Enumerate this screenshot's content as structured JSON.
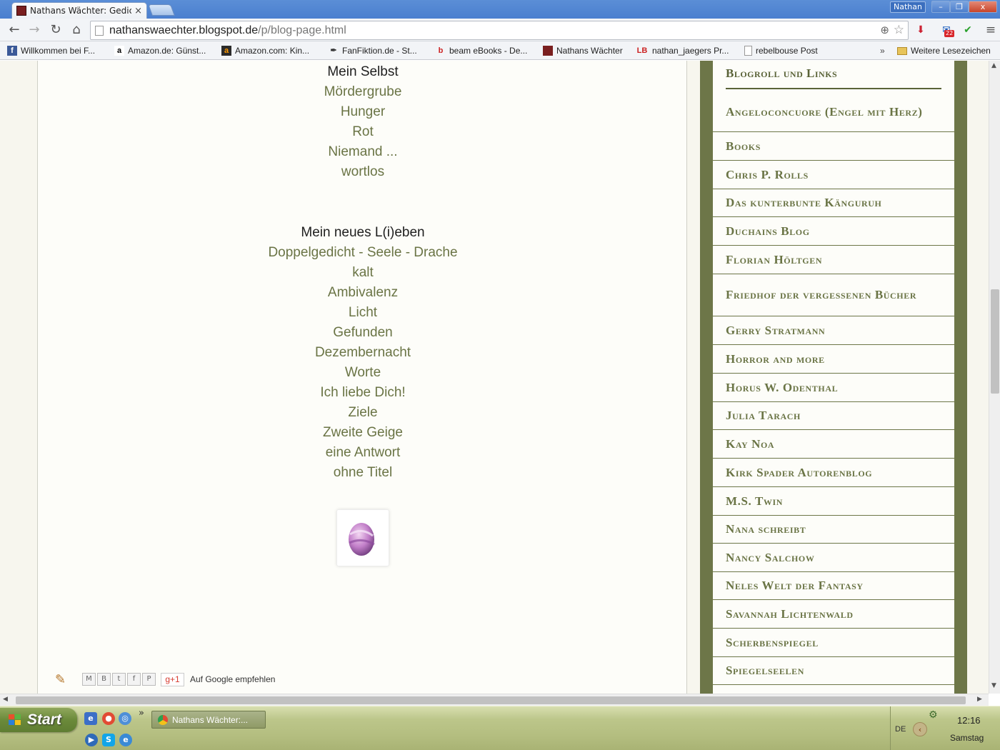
{
  "browser": {
    "tab_title": "Nathans Wächter: Gedic",
    "tab_close": "×",
    "user_name": "Nathan",
    "window_buttons": {
      "minimize": "–",
      "maximize": "❐",
      "close": "x"
    },
    "url_host": "nathanswaechter.blogspot.de",
    "url_path": "/p/blog-page.html",
    "mail_count": "22"
  },
  "bookmarks": [
    {
      "label": "Willkommen bei F...",
      "icon": "f"
    },
    {
      "label": "Amazon.de: Günst...",
      "icon": "a"
    },
    {
      "label": "Amazon.com: Kin...",
      "icon": "a"
    },
    {
      "label": "FanFiktion.de - St...",
      "icon": "✒"
    },
    {
      "label": "beam eBooks - De...",
      "icon": "b"
    },
    {
      "label": "Nathans Wächter",
      "icon": ""
    },
    {
      "label": "nathan_jaegers Pr...",
      "icon": "LB"
    },
    {
      "label": "rebelbouse Post",
      "icon": ""
    }
  ],
  "bookmarks_more": "»",
  "bookmarks_folder": "Weitere Lesezeichen",
  "poem_section_1": {
    "heading": "Mein Selbst",
    "items": [
      "Mördergrube",
      "Hunger",
      "Rot",
      "Niemand ...",
      "wortlos"
    ]
  },
  "poem_section_2": {
    "heading": "Mein neues L(i)eben",
    "items": [
      "Doppelgedicht - Seele - Drache",
      "kalt",
      "Ambivalenz",
      "Licht",
      "Gefunden",
      "Dezembernacht",
      "Worte",
      "Ich liebe Dich!",
      "Ziele",
      "Zweite Geige",
      "eine Antwort",
      "ohne Titel"
    ]
  },
  "share": {
    "gplus_label": "g+1",
    "recommend_text": "Auf Google empfehlen",
    "email": "M",
    "blog": "B",
    "twitter": "t",
    "facebook": "f",
    "pinterest": "P"
  },
  "sidebar": {
    "title": "Blogroll und Links",
    "links": [
      "Angeloconcuore (Engel mit Herz)",
      "Books",
      "Chris P. Rolls",
      "Das kunterbunte Känguruh",
      "Duchains Blog",
      "Florian Höltgen",
      "Friedhof der vergessenen Bücher",
      "Gerry Stratmann",
      "Horror and more",
      "Horus W. Odenthal",
      "Julia Tarach",
      "Kay Noa",
      "Kirk Spader Autorenblog",
      "M.S. Twin",
      "Nana schreibt",
      "Nancy Salchow",
      "Neles Welt der Fantasy",
      "Savannah Lichtenwald",
      "Scherbenspiegel",
      "Spiegelseelen"
    ]
  },
  "taskbar": {
    "start_label": "Start",
    "task_title": "Nathans Wächter:...",
    "quicklaunch_more": "»",
    "language": "DE",
    "time": "12:16",
    "day": "Samstag"
  }
}
